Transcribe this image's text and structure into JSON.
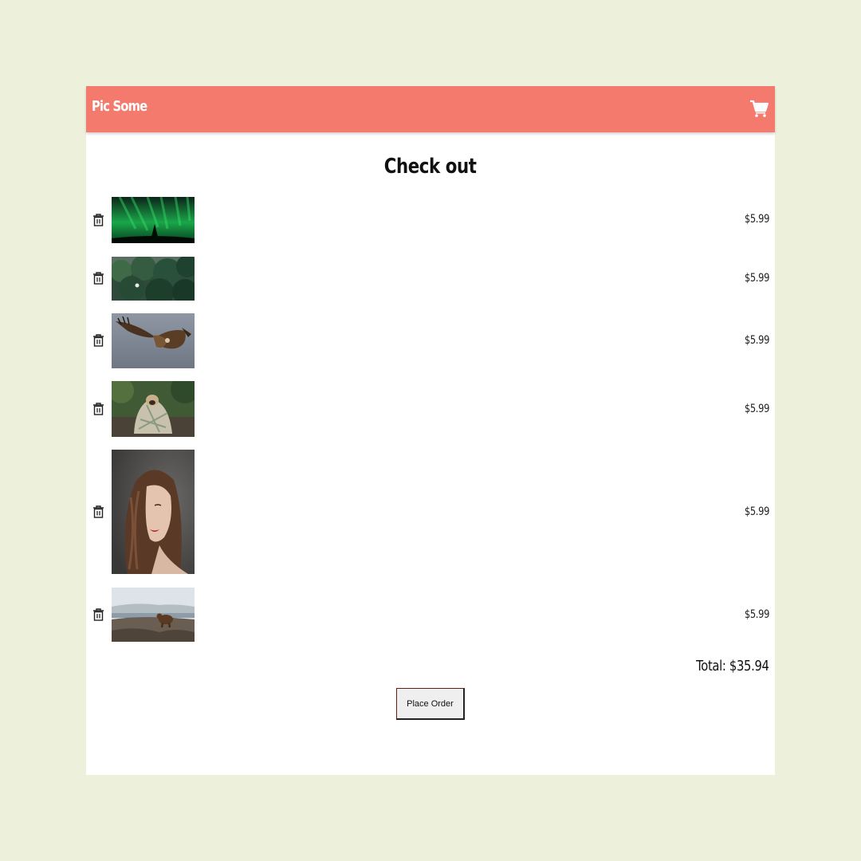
{
  "header": {
    "brand": "Pic Some",
    "cart_icon": "cart-icon"
  },
  "page": {
    "title": "Check out"
  },
  "cart": {
    "items": [
      {
        "price": "$5.99",
        "image": "aurora-over-trees"
      },
      {
        "price": "$5.99",
        "image": "forest-trees"
      },
      {
        "price": "$5.99",
        "image": "eagle-in-flight"
      },
      {
        "price": "$5.99",
        "image": "pug-in-blanket"
      },
      {
        "price": "$5.99",
        "image": "woman-portrait"
      },
      {
        "price": "$5.99",
        "image": "bear-on-rocks"
      }
    ],
    "total": "Total: $35.94"
  },
  "actions": {
    "place_order": "Place Order"
  },
  "colors": {
    "page_background": "#edf1dc",
    "header_background": "#f47a6e",
    "header_text": "#ffffff",
    "card_background": "#ffffff"
  }
}
